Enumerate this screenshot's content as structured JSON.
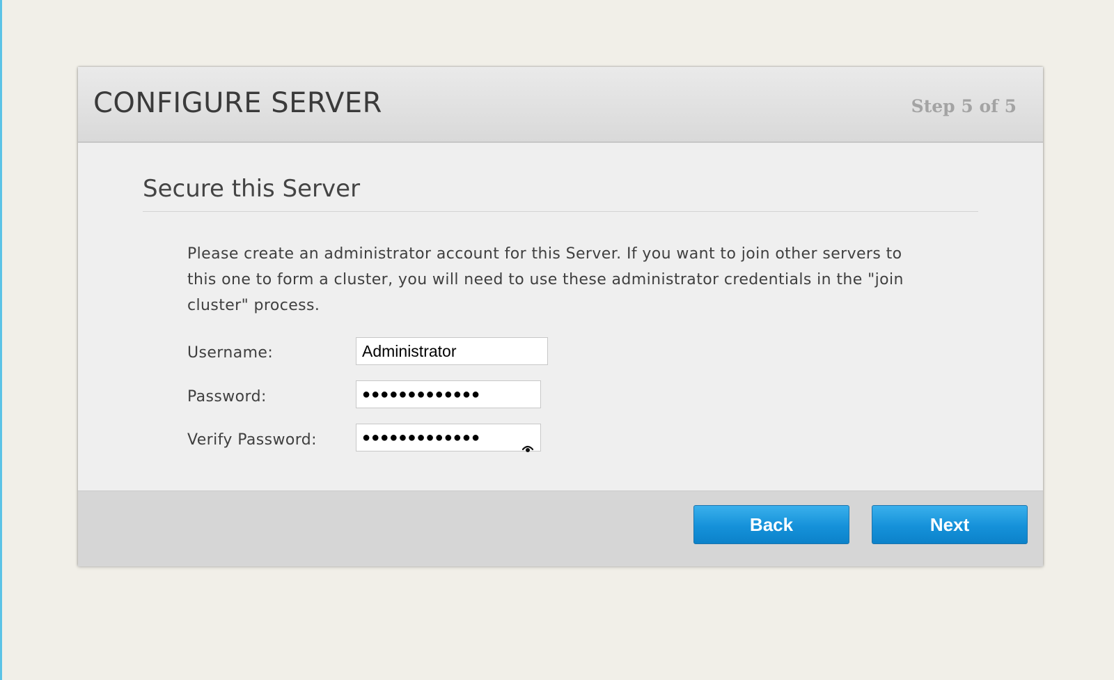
{
  "dialog": {
    "title": "CONFIGURE SERVER",
    "step": "Step 5 of 5"
  },
  "section": {
    "title": "Secure this Server",
    "description": "Please create an administrator account for this Server. If you want to join other servers to this one to form a cluster, you will need to use these administrator credentials in the \"join cluster\" process."
  },
  "form": {
    "username": {
      "label": "Username:",
      "value": "Administrator"
    },
    "password": {
      "label": "Password:",
      "masked_value": "●●●●●●●●●●●●●"
    },
    "verify_password": {
      "label": "Verify Password:",
      "masked_value": "●●●●●●●●●●●●●",
      "reveal_icon": "eye-icon"
    }
  },
  "footer": {
    "back_label": "Back",
    "next_label": "Next"
  },
  "colors": {
    "page_background": "#f1efe8",
    "button_blue": "#1591d9",
    "accent_edge": "#5bc3e6"
  }
}
